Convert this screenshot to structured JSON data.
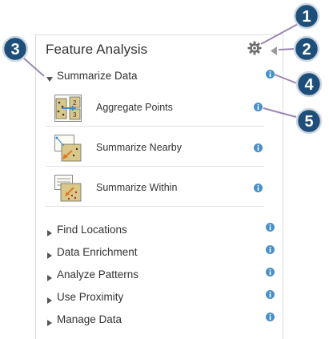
{
  "panel": {
    "title": "Feature Analysis"
  },
  "icons": {
    "gear": "gear-icon",
    "collapse": "collapse-left-icon",
    "info": "info-icon"
  },
  "colors": {
    "info_blue": "#4a90c8",
    "callout_blue": "#1e4f7a",
    "tool_icon_bg": "#d9c88a"
  },
  "expanded_section": {
    "label": "Summarize Data",
    "tools": [
      {
        "label": "Aggregate Points"
      },
      {
        "label": "Summarize Nearby"
      },
      {
        "label": "Summarize Within"
      }
    ]
  },
  "collapsed_sections": [
    {
      "label": "Find Locations"
    },
    {
      "label": "Data Enrichment"
    },
    {
      "label": "Analyze Patterns"
    },
    {
      "label": "Use Proximity"
    },
    {
      "label": "Manage Data"
    }
  ],
  "callouts": [
    "1",
    "2",
    "3",
    "4",
    "5"
  ]
}
